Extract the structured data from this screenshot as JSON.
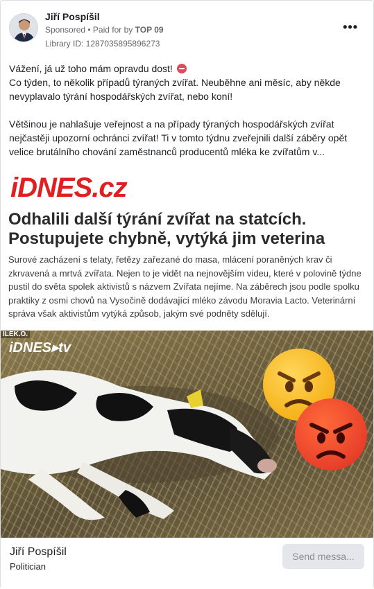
{
  "ad": {
    "advertiser": "Jiří Pospíšil",
    "sponsored": "Sponsored",
    "paid_for_prefix": "• Paid for by",
    "paid_for_by": "TOP 09",
    "library_id": "Library ID: 1287035895896273",
    "more_glyph": "•••"
  },
  "body": {
    "line1": "Vážení, já už toho mám opravdu dost!",
    "line2": "Co týden, to několik případů týraných zvířat. Neuběhne ani měsíc, aby někde nevyplavalo týrání hospodářských zvířat, nebo koní!",
    "line3": "Většinou je nahlašuje veřejnost a na případy týraných hospodářských zvířat nejčastěji upozorní ochránci zvířat! Ti v tomto týdnu zveřejnili další záběry opět velice brutálního chování zaměstnanců producentů mléka ke zvířatům v..."
  },
  "creative": {
    "logo": "iDNES.cz",
    "headline": "Odhalili další týrání zvířat na statcích. Postupujete chybně, vytýká jim veterina",
    "lead": "Surové zacházení s telaty, řetězy zařezané do masa, mlácení poraněných krav či zkrvavená a mrtvá zvířata. Nejen to je vidět na nejnovějším videu, které v polovině týdne pustil do světa spolek aktivistů s názvem Zvířata nejíme. Na záběrech jsou podle spolku praktiky z osmi chovů na Vysočině dodávající mléko závodu Moravia Lacto. Veterinární správa však aktivistům vytýká způsob, jakým své podněty sdělují.",
    "video_logo": "iDNES▸tv",
    "video_tag": "ILEK.O."
  },
  "footer": {
    "name": "Jiří Pospíšil",
    "role": "Politician",
    "send_button": "Send messa..."
  },
  "colors": {
    "brand_red": "#e02020",
    "text": "#1c1e21",
    "muted": "#65676b"
  }
}
